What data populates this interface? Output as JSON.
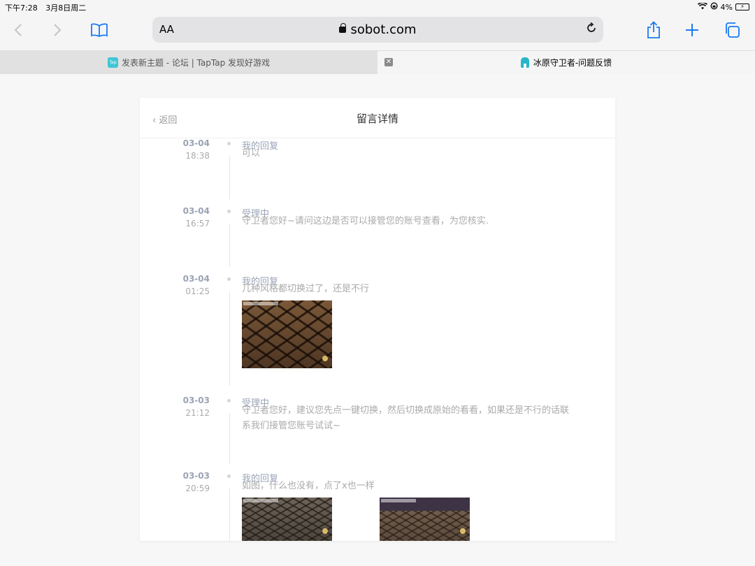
{
  "status_bar": {
    "time": "下午7:28",
    "date": "3月8日周二",
    "battery_percent": "4%"
  },
  "toolbar": {
    "text_size_label": "AA",
    "domain": "sobot.com"
  },
  "tabs": [
    {
      "label": "发表新主题 - 论坛 | TapTap 发现好游戏",
      "active": false,
      "favicon_text": "Tap"
    },
    {
      "label": "冰原守卫者-问题反馈",
      "active": true
    }
  ],
  "page": {
    "back_label": "返回",
    "title": "留言详情"
  },
  "entries": [
    {
      "date": "03-04",
      "time": "18:38",
      "type": "我的回复",
      "message": "可以",
      "images": 0
    },
    {
      "date": "03-04",
      "time": "16:57",
      "type": "受理中",
      "message": "守卫者您好~请问这边是否可以接管您的账号查看，为您核实.",
      "images": 0
    },
    {
      "date": "03-04",
      "time": "01:25",
      "type": "我的回复",
      "message": "几种风格都切换过了，还是不行",
      "images": 1
    },
    {
      "date": "03-03",
      "time": "21:12",
      "type": "受理中",
      "message": "守卫者您好，建议您先点一键切换，然后切换成原始的看看，如果还是不行的话联系我们接管您账号试试~",
      "images": 0
    },
    {
      "date": "03-03",
      "time": "20:59",
      "type": "我的回复",
      "message": "如图，什么也没有，点了x也一样",
      "images": 2
    }
  ],
  "colors": {
    "accent": "#1a7bf2",
    "muted_text": "#aaaaaa",
    "label_text": "#9aa3b5"
  }
}
